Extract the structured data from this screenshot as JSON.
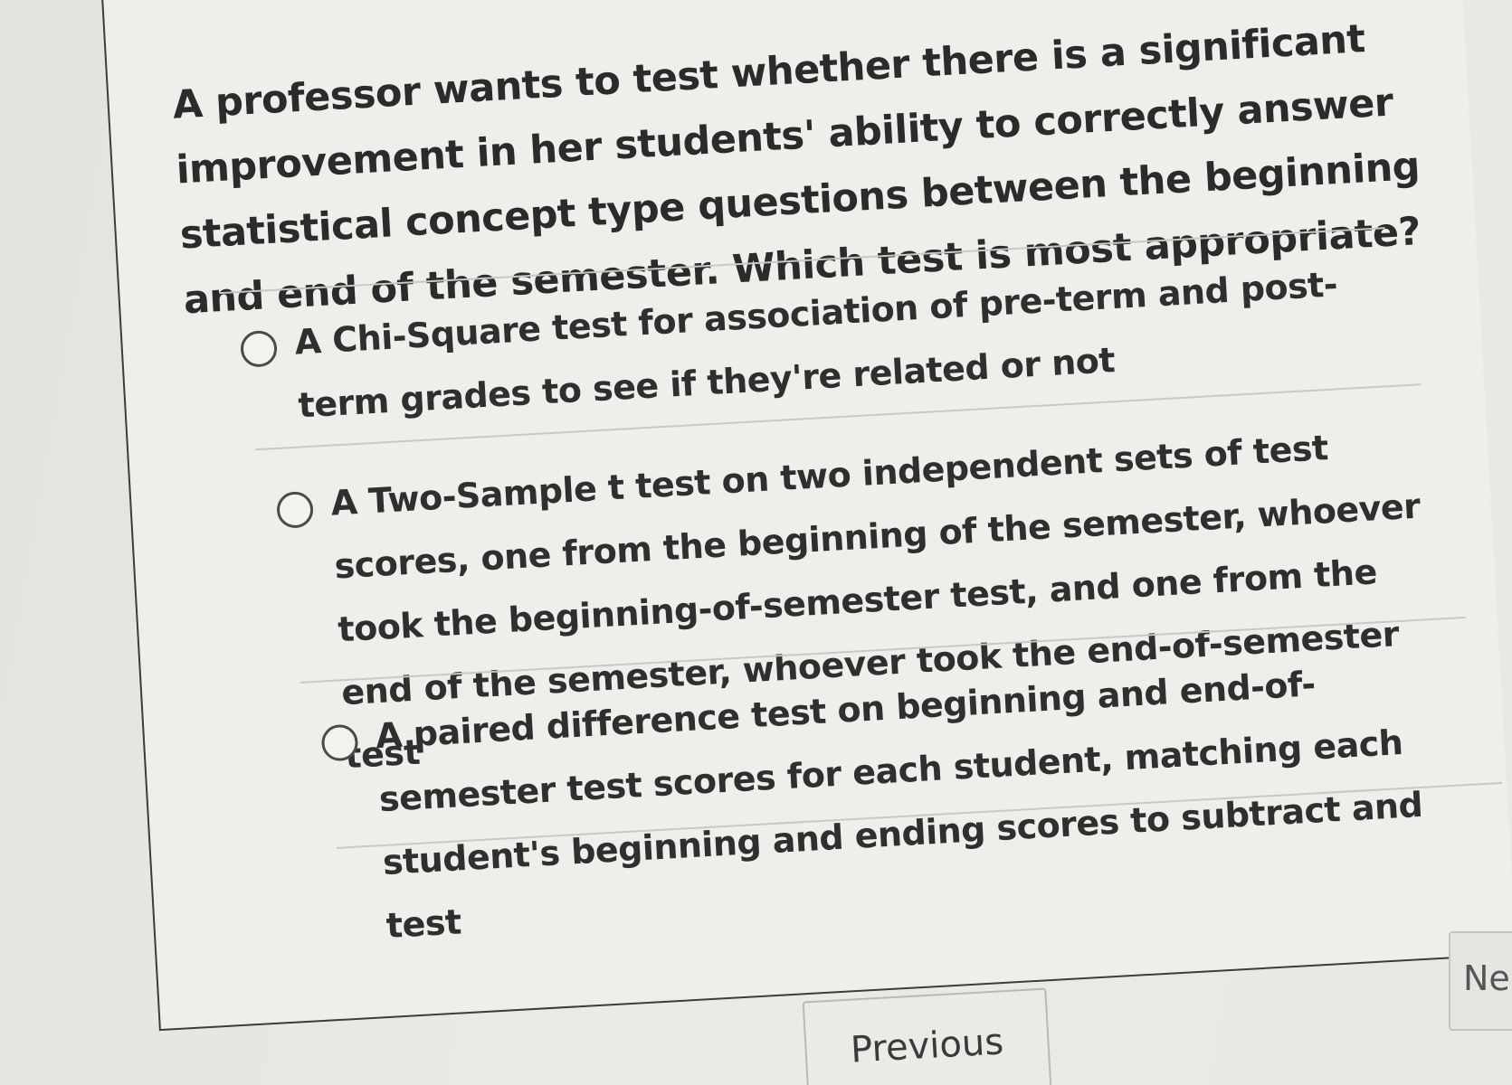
{
  "question": {
    "text": "A professor wants to test whether there is a significant improvement in her students' ability to correctly answer statistical concept type questions between the beginning and end of the semester. Which test is most appropriate?"
  },
  "options": [
    {
      "label": "A Chi-Square test for association of pre-term and post-term grades to see if they're related or not"
    },
    {
      "label": "A Two-Sample t test on two independent sets of test scores, one from the beginning of the semester, whoever took the beginning-of-semester test, and one from the end of the semester, whoever took the end-of-semester test"
    },
    {
      "label": "A paired difference test on beginning and end-of-semester test scores for each student, matching each student's beginning and ending scores to subtract and test"
    }
  ],
  "navigation": {
    "previous_label": "Previous",
    "next_label": "Ne"
  }
}
